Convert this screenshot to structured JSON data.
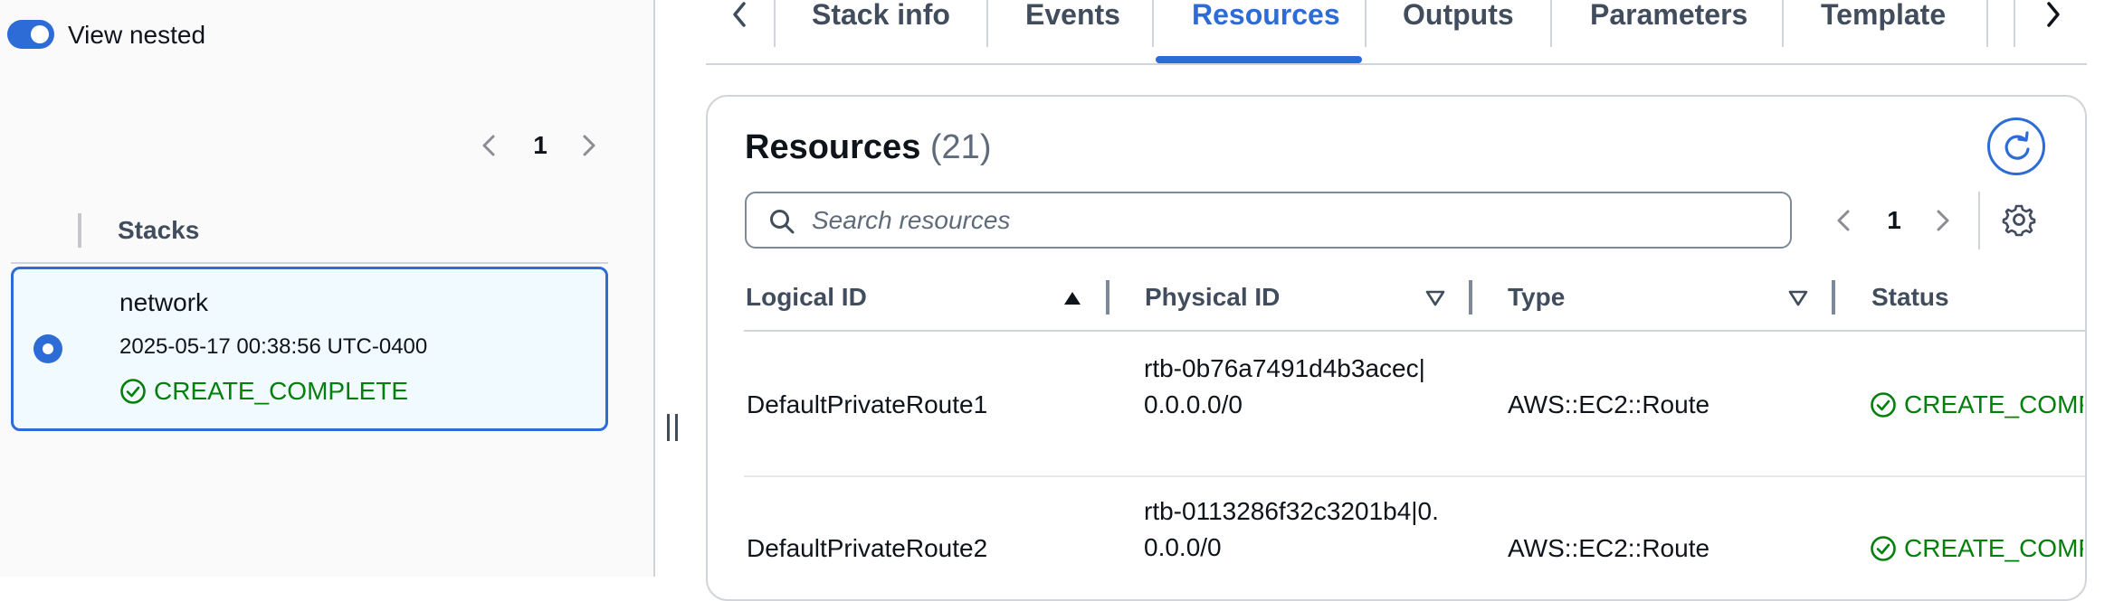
{
  "left_panel": {
    "view_nested_label": "View nested",
    "view_nested_on": true,
    "page_number": "1",
    "stacks_header": "Stacks",
    "stack": {
      "name": "network",
      "timestamp": "2025-05-17 00:38:56 UTC-0400",
      "status": "CREATE_COMPLETE",
      "selected": true
    }
  },
  "tabs": {
    "items": [
      {
        "label": "Stack info"
      },
      {
        "label": "Events"
      },
      {
        "label": "Resources",
        "active": true
      },
      {
        "label": "Outputs"
      },
      {
        "label": "Parameters"
      },
      {
        "label": "Template"
      }
    ]
  },
  "resources": {
    "title": "Resources",
    "count": "(21)",
    "search_placeholder": "Search resources",
    "page_number": "1",
    "columns": [
      "Logical ID",
      "Physical ID",
      "Type",
      "Status"
    ],
    "rows": [
      {
        "logical_id": "DefaultPrivateRoute1",
        "physical_id": "rtb-0b76a7491d4b3acec|0.0.0.0/0",
        "type": "AWS::EC2::Route",
        "status": "CREATE_COMP"
      },
      {
        "logical_id": "DefaultPrivateRoute2",
        "physical_id": "rtb-0113286f32c3201b4|0.0.0.0/0",
        "type": "AWS::EC2::Route",
        "status": "CREATE_COMP"
      }
    ]
  },
  "colors": {
    "accent": "#2d6cd6",
    "success": "#037f0c",
    "selected_bg": "#f1faff"
  }
}
